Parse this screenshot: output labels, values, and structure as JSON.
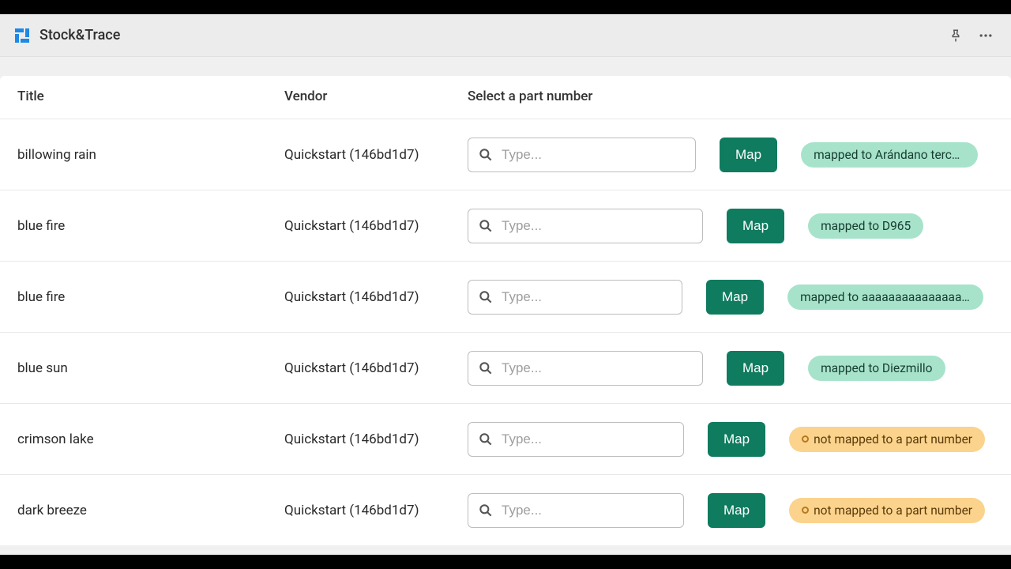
{
  "header": {
    "app_title": "Stock&Trace"
  },
  "table": {
    "headers": {
      "title": "Title",
      "vendor": "Vendor",
      "select": "Select a part number"
    },
    "input_placeholder": "Type...",
    "map_button_label": "Map",
    "rows": [
      {
        "title": "billowing rain",
        "vendor": "Quickstart (146bd1d7)",
        "search_width": 289,
        "status": "mapped",
        "status_text": "mapped to Arándano tercer...",
        "badge_max": 224
      },
      {
        "title": "blue fire",
        "vendor": "Quickstart (146bd1d7)",
        "search_width": 298,
        "status": "mapped",
        "status_text": "mapped to D965",
        "badge_max": 240
      },
      {
        "title": "blue fire",
        "vendor": "Quickstart (146bd1d7)",
        "search_width": 272,
        "status": "mapped",
        "status_text": "mapped to aaaaaaaaaaaaaaa...",
        "badge_max": 248
      },
      {
        "title": "blue sun",
        "vendor": "Quickstart (146bd1d7)",
        "search_width": 298,
        "status": "mapped",
        "status_text": "mapped to Diezmillo",
        "badge_max": 240
      },
      {
        "title": "crimson lake",
        "vendor": "Quickstart (146bd1d7)",
        "search_width": 274,
        "status": "unmapped",
        "status_text": "not mapped to a part number",
        "badge_max": 260
      },
      {
        "title": "dark breeze",
        "vendor": "Quickstart (146bd1d7)",
        "search_width": 274,
        "status": "unmapped",
        "status_text": "not mapped to a part number",
        "badge_max": 260
      }
    ]
  }
}
